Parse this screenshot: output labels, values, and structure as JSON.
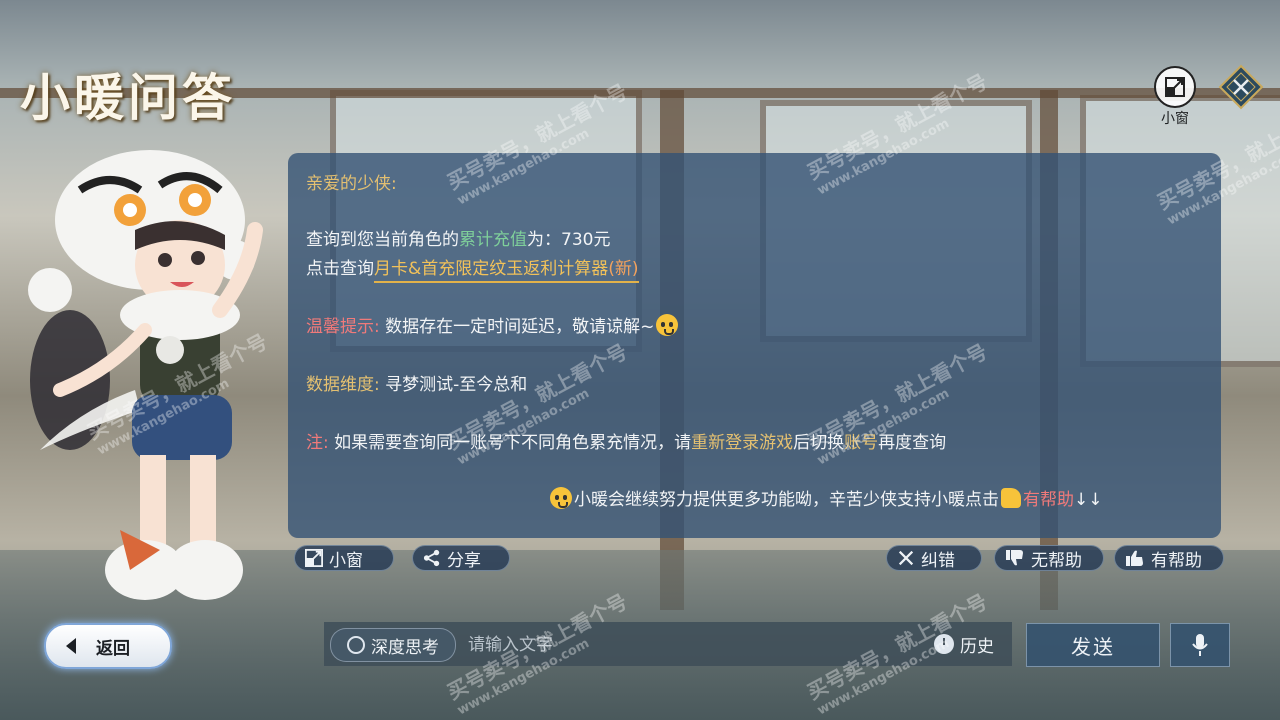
{
  "header": {
    "title": "小暖问答"
  },
  "top_controls": {
    "mini_window_label": "小窗"
  },
  "panel": {
    "greeting": "亲爱的少侠:",
    "query_prefix": "查询到您当前角色的",
    "query_highlight": "累计充值",
    "query_suffix": "为：730元",
    "click_prefix": "点击查询",
    "calc_link": "月卡&首充限定纹玉返利计算器",
    "calc_badge": "(新)",
    "tip_label": "温馨提示:",
    "tip_text": "数据存在一定时间延迟，敬请谅解~",
    "dim_label": "数据维度:",
    "dim_text": "寻梦测试-至今总和",
    "note_label": "注:",
    "note_text_1": "如果需要查询同一账号下不同角色累充情况，请",
    "note_hl_1": "重新登录游戏",
    "note_text_2": "后切换",
    "note_hl_2": "账号",
    "note_text_3": "再度查询",
    "closing_text": "小暖会继续努力提供更多功能呦，辛苦少侠支持小暖点击",
    "closing_hl": "有帮助",
    "closing_arrows": "↓↓"
  },
  "actions": {
    "mini_window": "小窗",
    "share": "分享",
    "correct": "纠错",
    "not_helpful": "无帮助",
    "helpful": "有帮助"
  },
  "bottom": {
    "back": "返回",
    "deep_think": "深度思考",
    "input_placeholder": "请输入文字",
    "history": "历史",
    "send": "发送"
  },
  "watermark": {
    "text": "买号卖号，就上看个号",
    "site": "www.kangehao.com"
  }
}
